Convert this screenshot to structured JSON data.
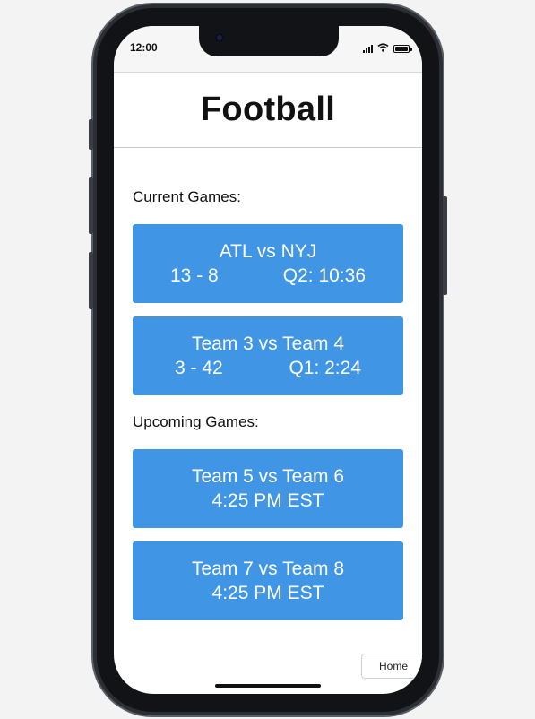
{
  "status_bar": {
    "time": "12:00",
    "icons": [
      "cellular-signal-icon",
      "wifi-icon",
      "battery-icon"
    ]
  },
  "header": {
    "title": "Football"
  },
  "current_games": {
    "label": "Current Games:",
    "games": [
      {
        "matchup": "ATL vs NYJ",
        "score": "13 - 8",
        "clock": "Q2: 10:36"
      },
      {
        "matchup": "Team 3 vs Team 4",
        "score": "3 - 42",
        "clock": "Q1: 2:24"
      }
    ]
  },
  "upcoming_games": {
    "label": "Upcoming Games:",
    "games": [
      {
        "matchup": "Team 5 vs Team 6",
        "start_time": "4:25 PM EST"
      },
      {
        "matchup": "Team 7 vs Team 8",
        "start_time": "4:25 PM EST"
      }
    ]
  },
  "nav": {
    "home_label": "Home"
  },
  "colors": {
    "card_background": "#4096e4",
    "card_text": "#ffffff",
    "device_frame": "#121316"
  }
}
